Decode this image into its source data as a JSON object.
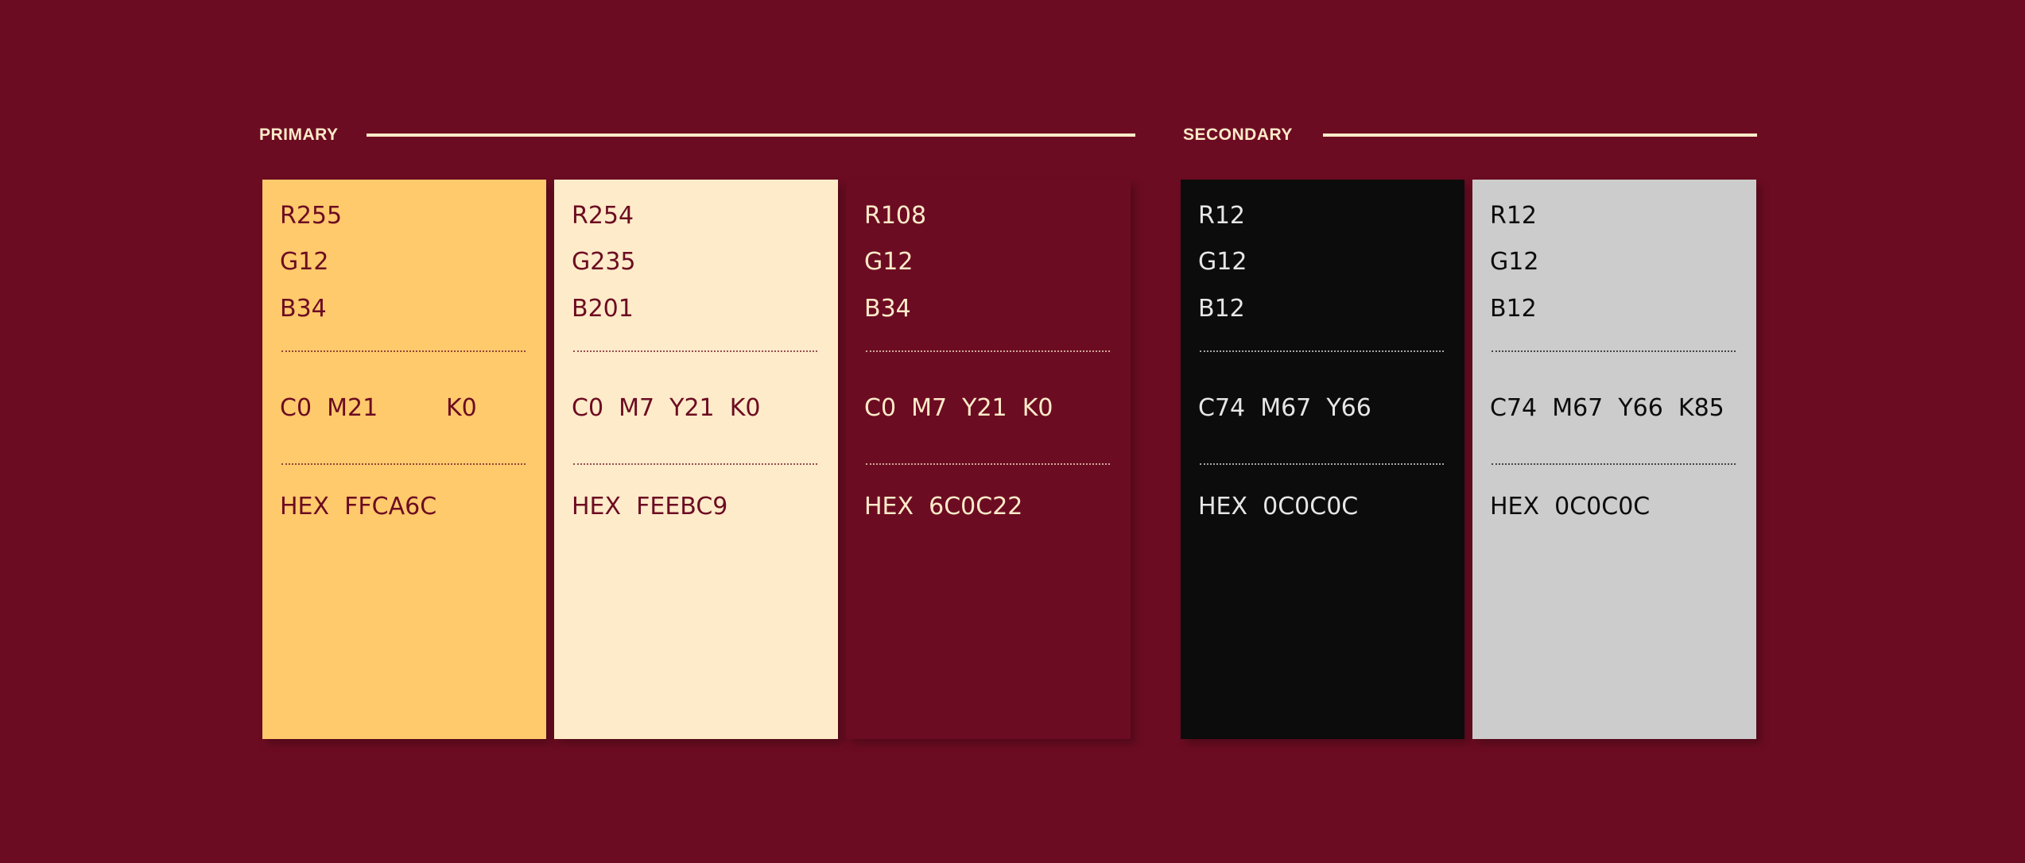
{
  "sections": {
    "primary_label": "PRIMARY",
    "secondary_label": "SECONDARY"
  },
  "swatches": [
    {
      "fill": "#FFCA6C",
      "text_color": "#6C0C22",
      "r": "R255",
      "g": "G12",
      "b": "B34",
      "cmyk": "C0  M21         K0",
      "hex": "HEX  FFCA6C"
    },
    {
      "fill": "#FEEBC9",
      "text_color": "#6C0C22",
      "r": "R254",
      "g": "G235",
      "b": "B201",
      "cmyk": "C0  M7  Y21  K0",
      "hex": "HEX  FEEBC9"
    },
    {
      "fill": "#6C0C22",
      "text_color": "#FEEBC9",
      "r": "R108",
      "g": "G12",
      "b": "B34",
      "cmyk": "C0  M7  Y21  K0",
      "hex": "HEX  6C0C22"
    },
    {
      "fill": "#0C0C0C",
      "text_color": "#E6E6E6",
      "r": "R12",
      "g": "G12",
      "b": "B12",
      "cmyk": "C74  M67  Y66",
      "hex": "HEX  0C0C0C"
    },
    {
      "fill": "#CCCCCC",
      "text_color": "#0C0C0C",
      "r": "R12",
      "g": "G12",
      "b": "B12",
      "cmyk": "C74  M67  Y66  K85",
      "hex": "HEX  0C0C0C"
    }
  ]
}
